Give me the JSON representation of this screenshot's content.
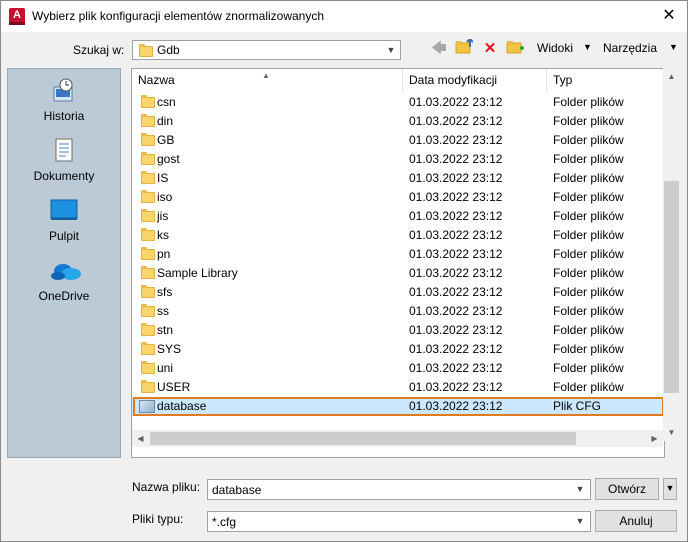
{
  "window": {
    "title": "Wybierz plik konfiguracji elementów znormalizowanych",
    "app_badge": "A"
  },
  "toolbar": {
    "look_in_label": "Szukaj w:",
    "look_in_value": "Gdb",
    "views_label": "Widoki",
    "tools_label": "Narzędzia"
  },
  "places": [
    {
      "label": "Historia",
      "icon": "history-icon"
    },
    {
      "label": "Dokumenty",
      "icon": "documents-icon"
    },
    {
      "label": "Pulpit",
      "icon": "desktop-icon"
    },
    {
      "label": "OneDrive",
      "icon": "onedrive-icon"
    }
  ],
  "columns": {
    "name": "Nazwa",
    "date": "Data modyfikacji",
    "type": "Typ"
  },
  "files": [
    {
      "name": "csn",
      "date": "01.03.2022 23:12",
      "type": "Folder plików"
    },
    {
      "name": "din",
      "date": "01.03.2022 23:12",
      "type": "Folder plików"
    },
    {
      "name": "GB",
      "date": "01.03.2022 23:12",
      "type": "Folder plików"
    },
    {
      "name": "gost",
      "date": "01.03.2022 23:12",
      "type": "Folder plików"
    },
    {
      "name": "IS",
      "date": "01.03.2022 23:12",
      "type": "Folder plików"
    },
    {
      "name": "iso",
      "date": "01.03.2022 23:12",
      "type": "Folder plików"
    },
    {
      "name": "jis",
      "date": "01.03.2022 23:12",
      "type": "Folder plików"
    },
    {
      "name": "ks",
      "date": "01.03.2022 23:12",
      "type": "Folder plików"
    },
    {
      "name": "pn",
      "date": "01.03.2022 23:12",
      "type": "Folder plików"
    },
    {
      "name": "Sample Library",
      "date": "01.03.2022 23:12",
      "type": "Folder plików"
    },
    {
      "name": "sfs",
      "date": "01.03.2022 23:12",
      "type": "Folder plików"
    },
    {
      "name": "ss",
      "date": "01.03.2022 23:12",
      "type": "Folder plików"
    },
    {
      "name": "stn",
      "date": "01.03.2022 23:12",
      "type": "Folder plików"
    },
    {
      "name": "SYS",
      "date": "01.03.2022 23:12",
      "type": "Folder plików"
    },
    {
      "name": "uni",
      "date": "01.03.2022 23:12",
      "type": "Folder plików"
    },
    {
      "name": "USER",
      "date": "01.03.2022 23:12",
      "type": "Folder plików"
    },
    {
      "name": "database",
      "date": "01.03.2022 23:12",
      "type": "Plik CFG"
    }
  ],
  "footer": {
    "filename_label": "Nazwa pliku:",
    "filename_value": "database",
    "filetype_label": "Pliki typu:",
    "filetype_value": "*.cfg",
    "open_label": "Otwórz",
    "cancel_label": "Anuluj"
  },
  "colors": {
    "highlight": "#e07b20",
    "places_bg": "#bccad6",
    "folder": "#f9d56b",
    "delete": "#e81123"
  }
}
